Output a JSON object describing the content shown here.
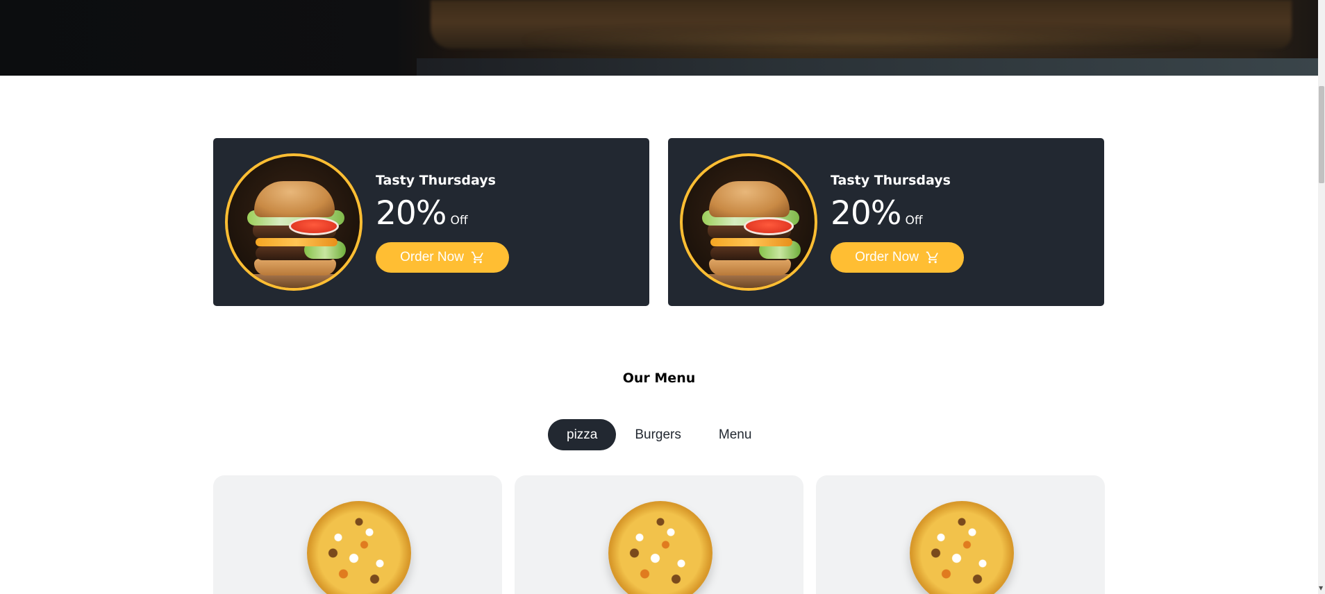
{
  "offers": [
    {
      "title": "Tasty Thursdays",
      "discount": "20%",
      "discount_suffix": "Off",
      "button_label": "Order Now",
      "image": "burger"
    },
    {
      "title": "Tasty Thursdays",
      "discount": "20%",
      "discount_suffix": "Off",
      "button_label": "Order Now",
      "image": "burger"
    }
  ],
  "menu": {
    "heading": "Our Menu",
    "filters": [
      {
        "label": "pizza",
        "active": true
      },
      {
        "label": "Burgers",
        "active": false
      },
      {
        "label": "Menu",
        "active": false
      }
    ],
    "products": [
      {
        "image": "pizza"
      },
      {
        "image": "pizza"
      },
      {
        "image": "pizza"
      }
    ]
  },
  "colors": {
    "accent": "#ffbe33",
    "dark": "#222831",
    "card_bg": "#f1f2f3"
  },
  "icons": {
    "cart": "shopping-cart-icon"
  }
}
